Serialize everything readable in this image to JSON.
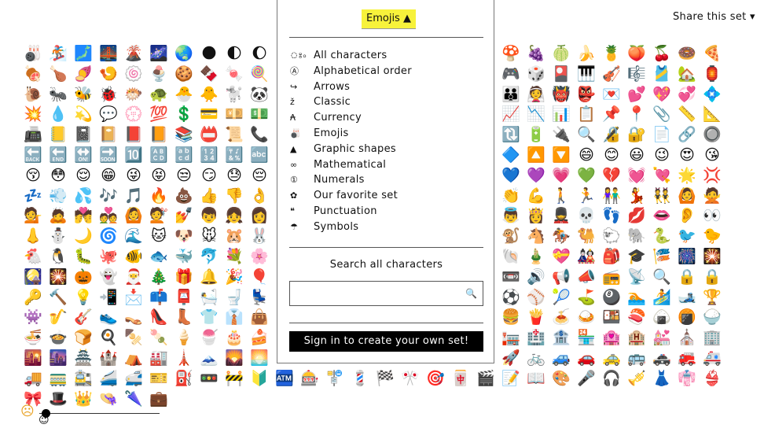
{
  "header": {
    "share_label": "Share this set ▾"
  },
  "panel": {
    "menu_button": "Emojis ▲",
    "categories": [
      {
        "icon": "ঃ৹",
        "label": "All characters"
      },
      {
        "icon": "Ⓐ",
        "label": "Alphabetical order"
      },
      {
        "icon": "↪",
        "label": "Arrows"
      },
      {
        "icon": "ž",
        "label": "Classic"
      },
      {
        "icon": "₳",
        "label": "Currency"
      },
      {
        "icon": "🎳",
        "label": "Emojis"
      },
      {
        "icon": "▲",
        "label": "Graphic shapes"
      },
      {
        "icon": "∞",
        "label": "Mathematical"
      },
      {
        "icon": "①",
        "label": "Numerals"
      },
      {
        "icon": "✿",
        "label": "Our favorite set"
      },
      {
        "icon": "❝",
        "label": "Punctuation"
      },
      {
        "icon": "☂",
        "label": "Symbols"
      }
    ],
    "search_label": "Search all characters",
    "search_value": "",
    "search_icon": "🔍",
    "signin_label": "Sign in to create your own set!"
  },
  "slider": {
    "min_icon": "☹",
    "max_icon": "☺",
    "value": 0.05
  },
  "emoji_grid": {
    "left": [
      [
        "🎳",
        "🏂",
        "🗾",
        "🌉",
        "🌋",
        "🌌",
        "🌏",
        "🌑",
        "🌓",
        "🌔"
      ],
      [
        "🍖",
        "🍗",
        "🍠",
        "🍤",
        "🍥",
        "🍨",
        "🍪",
        "🍫",
        "🍬",
        "🍭"
      ],
      [
        "🐌",
        "🐜",
        "🐝",
        "🐞",
        "🐡",
        "🐢",
        "🐣",
        "🐥",
        "🐩",
        "🐼"
      ],
      [
        "💥",
        "💧",
        "💫",
        "💬",
        "💮",
        "💯",
        "💲",
        "💳",
        "💴",
        "💵"
      ],
      [
        "📠",
        "📒",
        "📓",
        "📔",
        "📕",
        "📙",
        "📚",
        "📛",
        "📜",
        "📞"
      ],
      [
        "🔙",
        "🔚",
        "🔛",
        "🔜",
        "🔟",
        "🔠",
        "🔡",
        "🔢",
        "🔣",
        "🔤"
      ],
      [
        "😚",
        "😳",
        "😌",
        "😁",
        "😜",
        "😝",
        "😒",
        "😏",
        "😓",
        "😔"
      ],
      [
        "💤",
        "💨",
        "💦",
        "🎶",
        "🎵",
        "🔥",
        "💩",
        "👍",
        "👎",
        "👌"
      ],
      [
        "💁",
        "🙇",
        "💏",
        "💑",
        "🙆",
        "💇",
        "💅",
        "👦",
        "👧",
        "👩"
      ],
      [
        "👃",
        "⛄",
        "🌙",
        "🌀",
        "🌊",
        "🐱",
        "🐶",
        "🐭",
        "🐹",
        "🐰"
      ],
      [
        "🐔",
        "🐧",
        "🐛",
        "🐙",
        "🐠",
        "🐟",
        "🐳",
        "🐬",
        "💐",
        "🌸"
      ],
      [
        "🎑",
        "🎇",
        "🎃",
        "👻",
        "🎅",
        "🎄",
        "🎁",
        "🔔",
        "🎉",
        "🎈"
      ],
      [
        "🔑",
        "🔨",
        "💡",
        "📲",
        "📩",
        "📫",
        "📮",
        "🛀",
        "🚽",
        "💺"
      ],
      [
        "👾",
        "🎷",
        "🎸",
        "👟",
        "👡",
        "👠",
        "👢",
        "👕",
        "👔",
        "👜"
      ],
      [
        "🍜",
        "🍲",
        "🍞",
        "🍳",
        "🍢",
        "🍡",
        "🍦",
        "🍧",
        "🎂",
        "🍰"
      ],
      [
        "🌇",
        "🌆",
        "🏯",
        "🏰",
        "⛺",
        "🏭",
        "🗼",
        "🗻",
        "🌄",
        "🌅"
      ],
      [
        "🚚",
        "🚃",
        "🚉",
        "🚄",
        "🚅",
        "🎫",
        "⛽",
        "🚥",
        "🚧",
        "🔰"
      ],
      [
        "🎀",
        "🎩",
        "👑",
        "👒",
        "🌂",
        "💼"
      ]
    ],
    "middle_bottom_row": [
      "🏧",
      "🎰",
      "🚏",
      "💈",
      "🏁",
      "🎌",
      "🎯",
      "🀄",
      "🎬"
    ],
    "right": [
      [
        "🍄",
        "🍇",
        "🍈",
        "🍌",
        "🍍",
        "🍑",
        "🍒",
        "🍩",
        "🍕"
      ],
      [
        "🎮",
        "🎲",
        "🎴",
        "🎹",
        "🎻",
        "🎼",
        "🎽",
        "🏡",
        "🏮"
      ],
      [
        "👪",
        "👰",
        "👹",
        "👺",
        "💌",
        "💕",
        "💖",
        "💞",
        "💠"
      ],
      [
        "📈",
        "📉",
        "📊",
        "📋",
        "📌",
        "📍",
        "📎",
        "📏",
        "📐"
      ],
      [
        "🔃",
        "🔋",
        "🔌",
        "🔍",
        "🔏",
        "🔐",
        "📄",
        "🔗",
        "🔘"
      ],
      [
        "🔷",
        "🔼",
        "🔽",
        "😄",
        "😊",
        "😃",
        "😉",
        "😍",
        "😘"
      ],
      [
        "💙",
        "💜",
        "💗",
        "💚",
        "💔",
        "💓",
        "💘",
        "🌟",
        "💢"
      ],
      [
        "👏",
        "💪",
        "🚶",
        "🏃",
        "👫",
        "💃",
        "👯",
        "🙆",
        "🙅"
      ],
      [
        "👼",
        "👸",
        "💂",
        "💀",
        "👣",
        "💋",
        "👄",
        "👂",
        "👀"
      ],
      [
        "🐒",
        "🐴",
        "🏇",
        "🐫",
        "🐑",
        "🐘",
        "🐍",
        "🐦",
        "🐤"
      ],
      [
        "🐚",
        "🎍",
        "💝",
        "🎎",
        "🎒",
        "🎓",
        "🎏",
        "🎆",
        "🎇"
      ],
      [
        "📼",
        "🔊",
        "📢",
        "📣",
        "📻",
        "📡",
        "🔍",
        "🔒",
        "🔒"
      ],
      [
        "⚽",
        "⚾",
        "🎾",
        "⛳",
        "🎱",
        "🏊",
        "🏄",
        "🎿",
        "🏆"
      ],
      [
        "🍔",
        "🍟",
        "🍝",
        "🍛",
        "🍱",
        "🍣",
        "🍙",
        "🍘",
        "🍚"
      ],
      [
        "🏣",
        "🏥",
        "🏦",
        "🏪",
        "🏩",
        "🏨",
        "💒",
        "⛪",
        "🏢"
      ],
      [
        "🚀",
        "🚲",
        "🚙",
        "🚗",
        "🚕",
        "🚌",
        "🚓",
        "🚒",
        "🚑"
      ],
      [
        "📝",
        "📖",
        "🎨",
        "🎤",
        "🎧",
        "🎺",
        "👗",
        "👘",
        "👙"
      ]
    ]
  }
}
